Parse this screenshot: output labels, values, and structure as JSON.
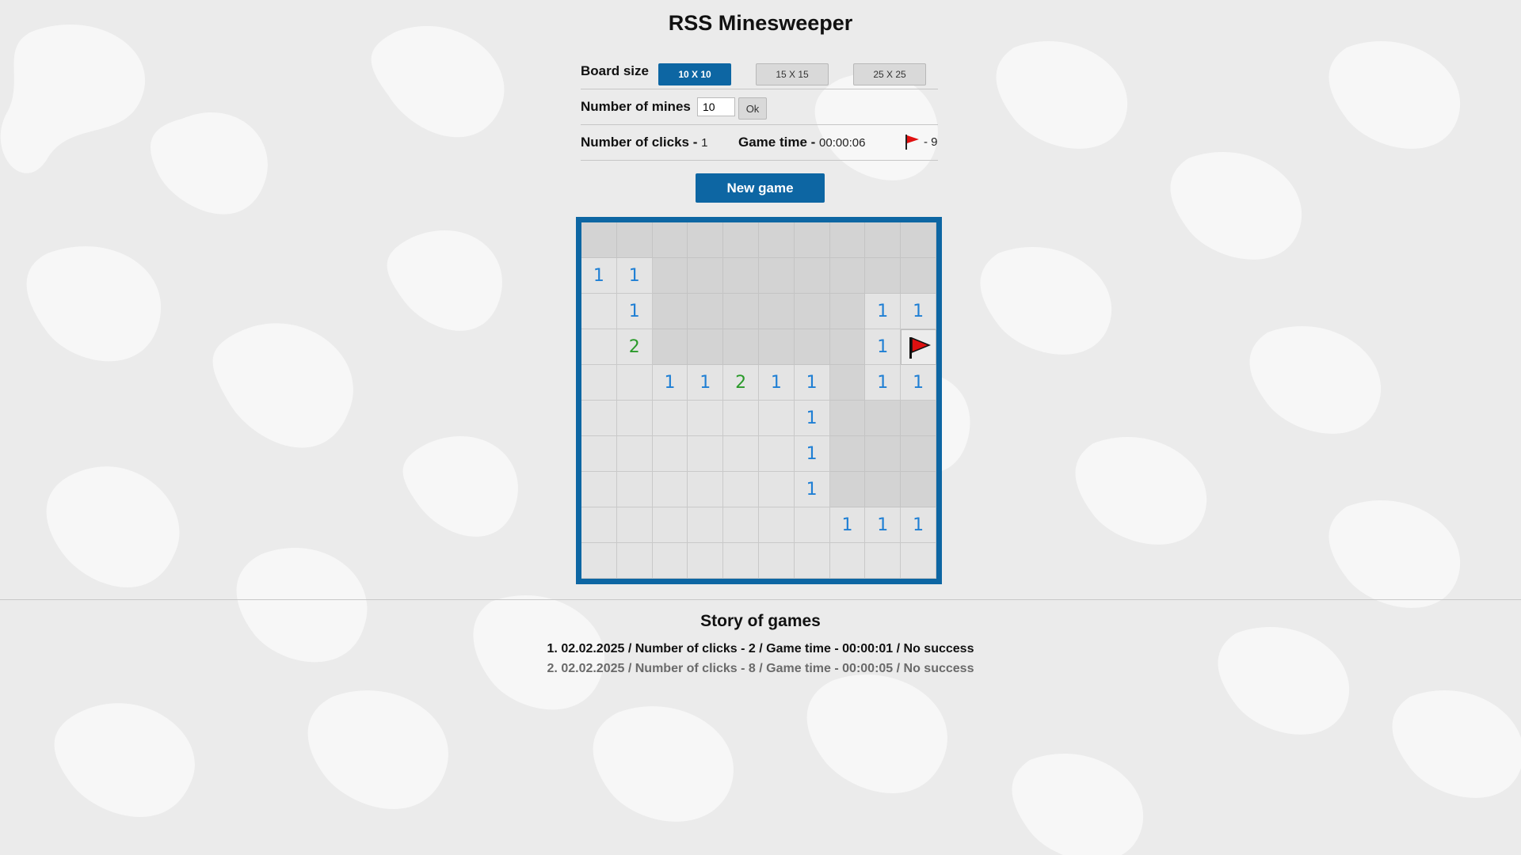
{
  "title": "RSS Minesweeper",
  "board_size": {
    "label": "Board size",
    "options": [
      "10 X 10",
      "15 X 15",
      "25 X 25"
    ],
    "selected": "10 X 10"
  },
  "mines": {
    "label": "Number of mines",
    "value": "10",
    "ok_label": "Ok"
  },
  "stats": {
    "clicks_label": "Number of clicks - ",
    "clicks_value": "1",
    "time_label": "Game time - ",
    "time_value": "00:00:06",
    "flags_value": "- 9"
  },
  "new_game_label": "New game",
  "board": {
    "rows": [
      [
        "#",
        "#",
        "#",
        "#",
        "#",
        "#",
        "#",
        "#",
        "#",
        "#"
      ],
      [
        "1",
        "1",
        "#",
        "#",
        "#",
        "#",
        "#",
        "#",
        "#",
        "#"
      ],
      [
        "",
        "1",
        "#",
        "#",
        "#",
        "#",
        "#",
        "#",
        "1",
        "1"
      ],
      [
        "",
        "2",
        "#",
        "#",
        "#",
        "#",
        "#",
        "#",
        "1",
        "F"
      ],
      [
        "",
        "",
        "1",
        "1",
        "2",
        "1",
        "1",
        "#",
        "1",
        "1"
      ],
      [
        "",
        "",
        "",
        "",
        "",
        "",
        "1",
        "#",
        "#",
        "#"
      ],
      [
        "",
        "",
        "",
        "",
        "",
        "",
        "1",
        "#",
        "#",
        "#"
      ],
      [
        "",
        "",
        "",
        "",
        "",
        "",
        "1",
        "#",
        "#",
        "#"
      ],
      [
        "",
        "",
        "",
        "",
        "",
        "",
        "",
        "1",
        "1",
        "1"
      ],
      [
        "",
        "",
        "",
        "",
        "",
        "",
        "",
        "",
        "",
        ""
      ]
    ]
  },
  "story": {
    "title": "Story of games",
    "entries": [
      "1. 02.02.2025 / Number of clicks - 2 / Game time - 00:00:01 / No success",
      "2. 02.02.2025 / Number of clicks - 8 / Game time - 00:00:05 / No success"
    ]
  },
  "colors": {
    "accent": "#0d66a3",
    "one": "#1f7fd4",
    "two": "#2a9a2a",
    "flag": "#e01010"
  }
}
